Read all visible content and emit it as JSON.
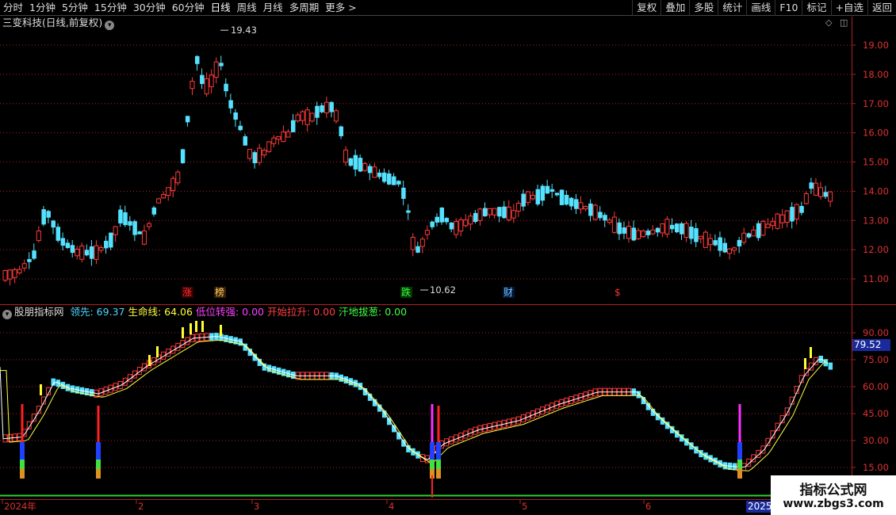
{
  "toolbar": {
    "left_items": [
      "分时",
      "1分钟",
      "5分钟",
      "15分钟",
      "30分钟",
      "60分钟",
      "日线",
      "周线",
      "月线",
      "多周期",
      "更多 >"
    ],
    "active": "日线",
    "right_items": [
      "复权",
      "叠加",
      "多股",
      "统计",
      "画线",
      "F10",
      "标记",
      "+自选",
      "返回"
    ]
  },
  "main_title": "三变科技(日线,前复权)",
  "indicator": {
    "name": "股朋指标网",
    "series": [
      {
        "label": "领先",
        "value": "69.37",
        "color": "#4fd8ff"
      },
      {
        "label": "生命线",
        "value": "64.06",
        "color": "#ffff40"
      },
      {
        "label": "低位转强",
        "value": "0.00",
        "color": "#ff40ff"
      },
      {
        "label": "开始拉升",
        "value": "0.00",
        "color": "#ff4040"
      },
      {
        "label": "汗地拔葱",
        "value": "0.00",
        "color": "#40ff40"
      }
    ],
    "current_value": "79.52"
  },
  "price_axis": {
    "ticks": [
      "19.00",
      "18.00",
      "17.00",
      "16.00",
      "15.00",
      "14.00",
      "13.00",
      "12.00",
      "11.00"
    ]
  },
  "indicator_axis": {
    "ticks": [
      "90.00",
      "75.00",
      "60.00",
      "45.00",
      "30.00",
      "15.00"
    ]
  },
  "x_axis": {
    "labels": [
      "2024年",
      "2",
      "3",
      "4",
      "5",
      "6"
    ],
    "current_date": "2025/"
  },
  "annotations": {
    "high": "19.43",
    "low": "10.62",
    "markers": [
      "涨",
      "榜",
      "跌",
      "财",
      "$"
    ]
  },
  "watermark": {
    "title": "指标公式网",
    "url": "www.zbgs3.com"
  },
  "chart_data": {
    "type": "candlestick",
    "ylim": [
      10.5,
      19.8
    ],
    "indicator_ylim": [
      5,
      100
    ]
  }
}
